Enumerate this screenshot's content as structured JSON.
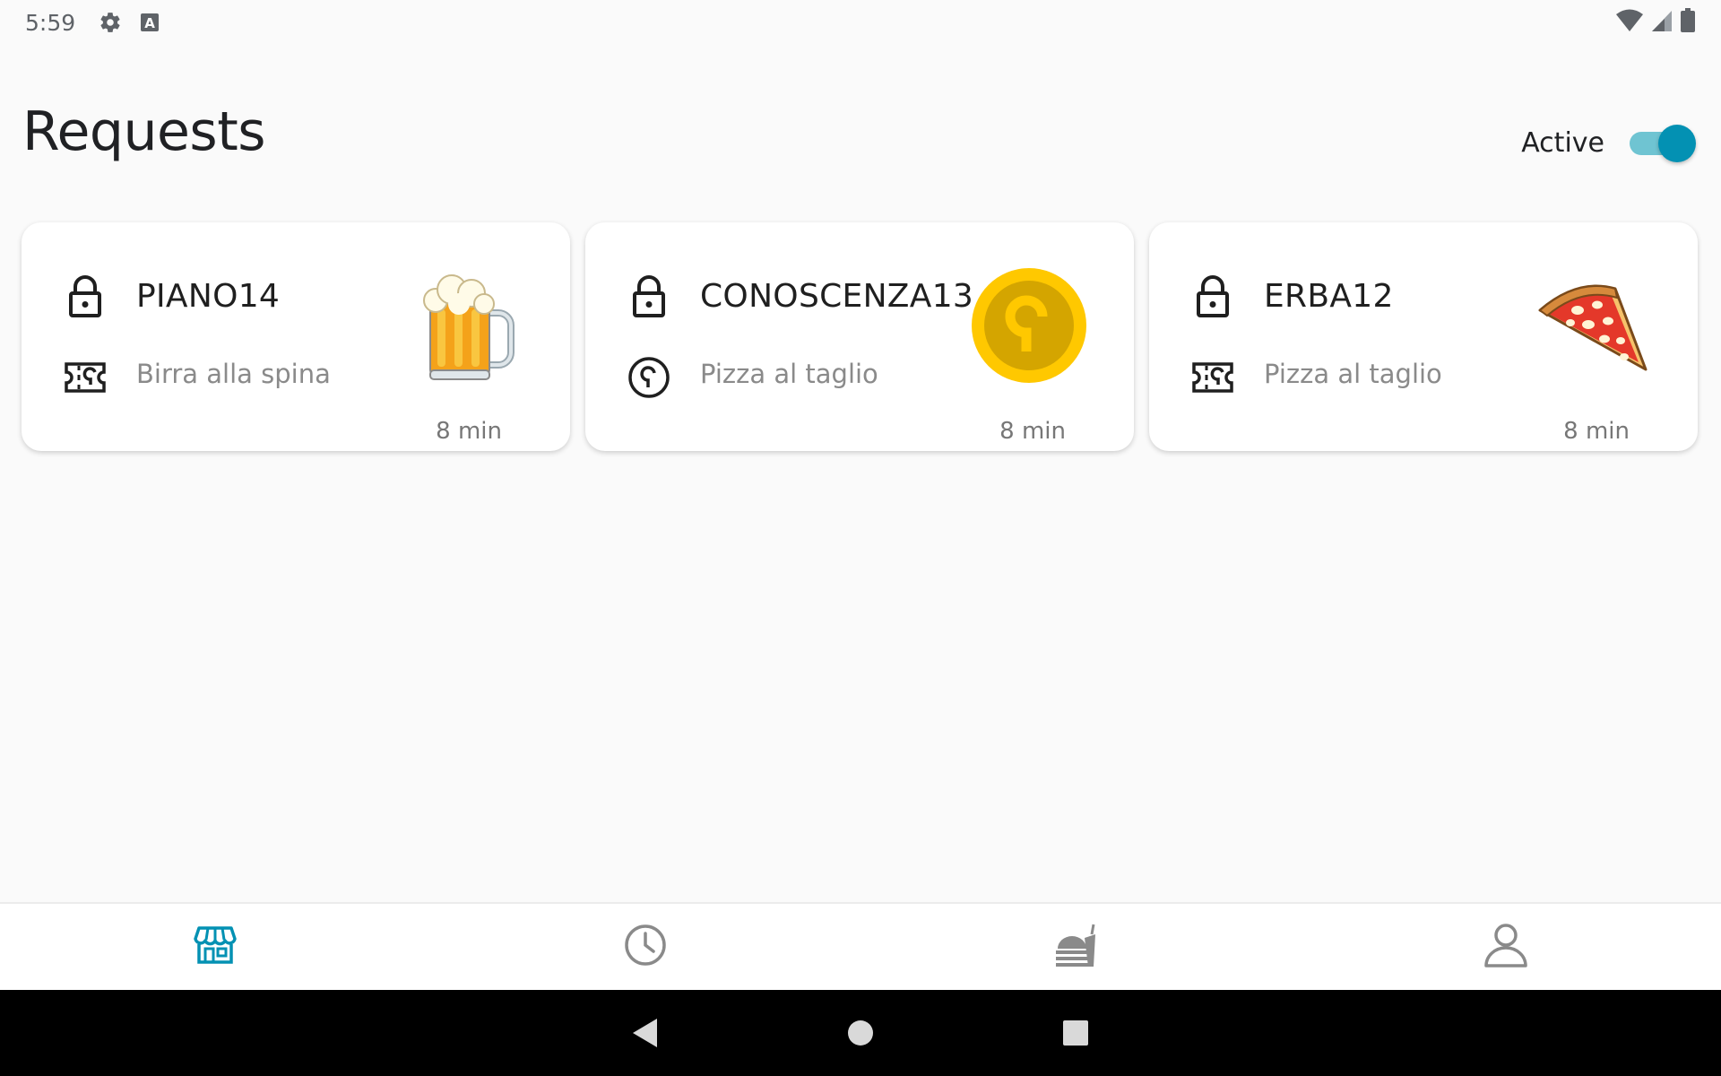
{
  "status_bar": {
    "time": "5:59",
    "left_icons": [
      "gear-icon",
      "keyboard-a-icon"
    ],
    "right_icons": [
      "wifi-icon",
      "cell-signal-icon",
      "battery-icon"
    ]
  },
  "header": {
    "title": "Requests",
    "active_label": "Active",
    "active_on": true
  },
  "requests": [
    {
      "code": "PIANO14",
      "type_icon": "ticket-icon",
      "product": "Birra alla spina",
      "time": "8 min",
      "image": "beer-mug-image"
    },
    {
      "code": "CONOSCENZA13",
      "type_icon": "coin-icon",
      "product": "Pizza al taglio",
      "time": "8 min",
      "image": "gold-coin-image"
    },
    {
      "code": "ERBA12",
      "type_icon": "ticket-icon",
      "product": "Pizza al taglio",
      "time": "8 min",
      "image": "pizza-slice-image"
    }
  ],
  "bottom_nav": {
    "items": [
      "store-icon",
      "clock-icon",
      "food-icon",
      "person-icon"
    ],
    "active_index": 0
  },
  "colors": {
    "accent": "#0391b3",
    "accent_track": "#6fc4d2",
    "coin_gold": "#ffc800",
    "coin_inner": "#d4a500",
    "nav_inactive": "#8a8a8a"
  }
}
